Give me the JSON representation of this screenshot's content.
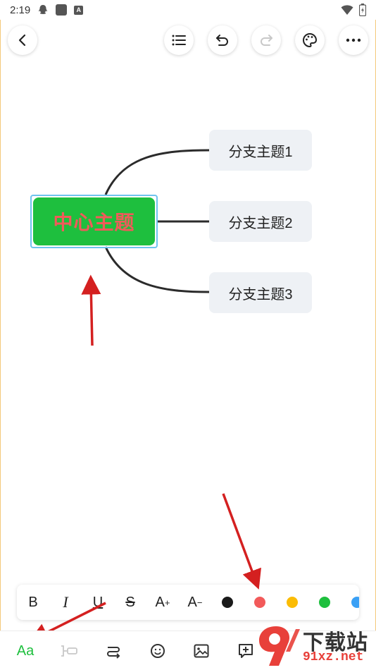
{
  "status_bar": {
    "time": "2:19"
  },
  "mindmap": {
    "central": "中心主题",
    "branches": [
      "分支主题1",
      "分支主题2",
      "分支主题3"
    ]
  },
  "format_toolbar": {
    "bold": "B",
    "italic": "I",
    "underline": "U",
    "strike": "S",
    "size_up": "A",
    "size_down": "A",
    "colors": [
      "#1a1a1a",
      "#f25a5a",
      "#fbbc05",
      "#1ebf3e",
      "#3aa0f5"
    ]
  },
  "bottom_bar": {
    "text_style_label": "Aa"
  },
  "colors": {
    "central_fill": "#1ebf3e",
    "central_text": "#f25a5a",
    "selection": "#6ec3ee",
    "branch_fill": "#eef1f5",
    "arrow": "#d42020"
  },
  "watermark": {
    "text": "下载站",
    "url": "91xz.net"
  }
}
